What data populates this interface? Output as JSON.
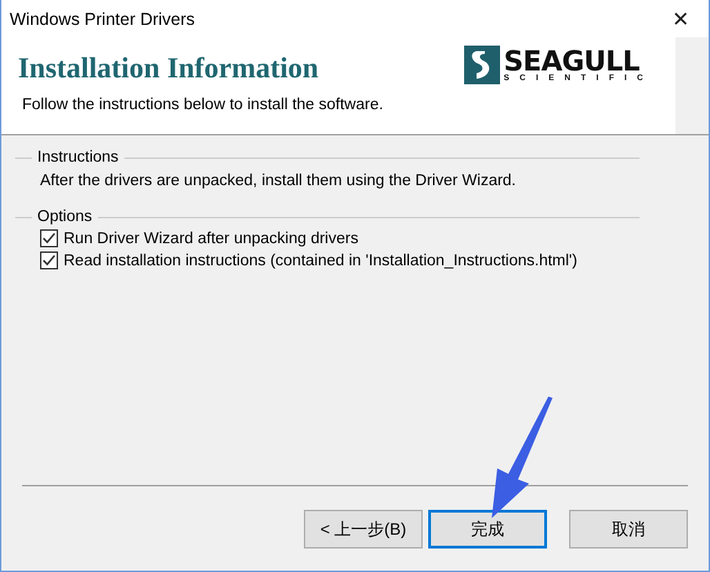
{
  "window": {
    "title": "Windows Printer Drivers",
    "close": "✕"
  },
  "header": {
    "title": "Installation Information",
    "subtitle": "Follow the instructions below to install the software.",
    "logo": {
      "name": "SEAGULL",
      "tagline": "SCIENTIFIC"
    }
  },
  "instructions": {
    "legend": "Instructions",
    "text": "After the drivers are unpacked, install them using the Driver Wizard."
  },
  "options": {
    "legend": "Options",
    "items": [
      {
        "label": "Run Driver Wizard after unpacking drivers",
        "checked": true
      },
      {
        "label": "Read installation instructions (contained in 'Installation_Instructions.html')",
        "checked": true
      }
    ]
  },
  "buttons": [
    {
      "label": "< 上一步(B)",
      "selected": false
    },
    {
      "label": "完成",
      "selected": true
    },
    {
      "label": "取消",
      "selected": false
    }
  ]
}
